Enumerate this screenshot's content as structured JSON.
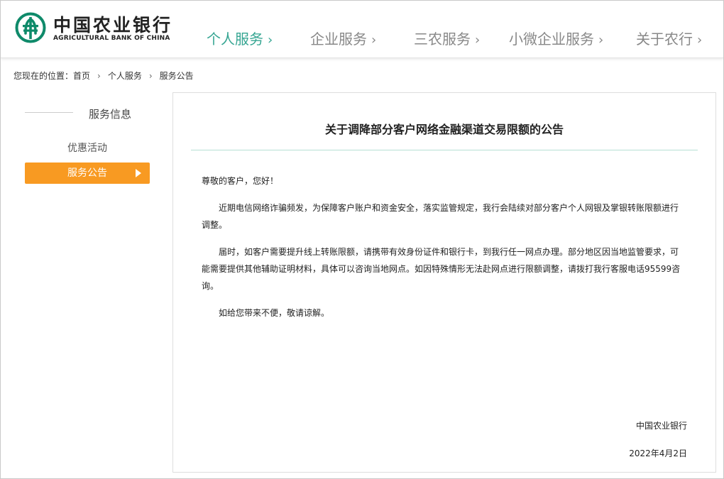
{
  "header": {
    "brand_cn": "中国农业银行",
    "brand_en": "AGRICULTURAL BANK OF CHINA",
    "nav": [
      {
        "label": "个人服务",
        "active": true
      },
      {
        "label": "企业服务",
        "active": false
      },
      {
        "label": "三农服务",
        "active": false
      },
      {
        "label": "小微企业服务",
        "active": false
      },
      {
        "label": "关于农行",
        "active": false
      }
    ],
    "chevron": "›",
    "colors": {
      "accent": "#35a592",
      "logo": "#0f8a6a",
      "nav_text": "#888888"
    }
  },
  "breadcrumb": {
    "prefix": "您现在的位置：",
    "items": [
      "首页",
      "个人服务",
      "服务公告"
    ],
    "separator": "›"
  },
  "sidebar": {
    "heading": "服务信息",
    "items": [
      {
        "label": "优惠活动",
        "active": false
      },
      {
        "label": "服务公告",
        "active": true
      }
    ],
    "colors": {
      "active_bg": "#f89a22"
    }
  },
  "article": {
    "title": "关于调降部分客户网络金融渠道交易限额的公告",
    "salutation": "尊敬的客户，您好！",
    "paragraphs": [
      "近期电信网络诈骗频发，为保障客户账户和资金安全，落实监管规定，我行会陆续对部分客户个人网银及掌银转账限额进行调整。",
      "届时，如客户需要提升线上转账限额，请携带有效身份证件和银行卡，到我行任一网点办理。部分地区因当地监管要求，可能需要提供其他辅助证明材料，具体可以咨询当地网点。如因特殊情形无法赴网点进行限额调整，请拨打我行客服电话95599咨询。",
      "如给您带来不便，敬请谅解。"
    ],
    "signature": "中国农业银行",
    "date": "2022年4月2日"
  }
}
